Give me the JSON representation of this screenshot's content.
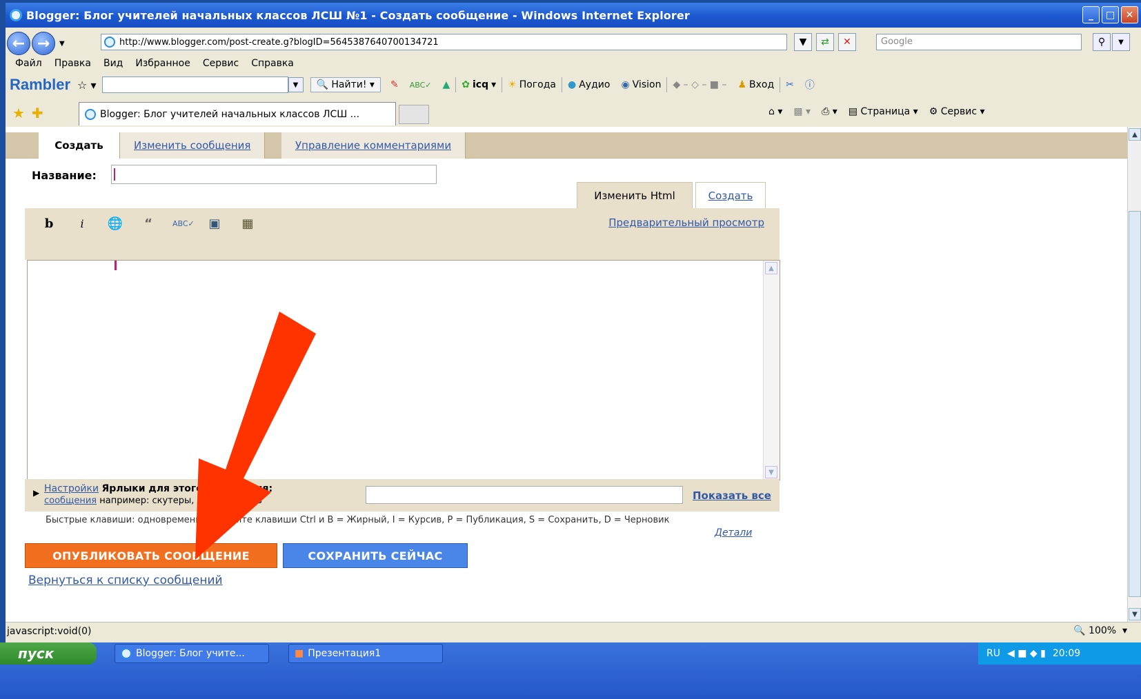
{
  "window": {
    "title": "Blogger: Блог учителей начальных классов ЛСШ №1 - Создать сообщение - Windows Internet Explorer",
    "buttons": [
      "_",
      "□",
      "✕"
    ]
  },
  "address": {
    "url": "http://www.blogger.com/post-create.g?blogID=5645387640700134721",
    "search_placeholder": "Google"
  },
  "menu": [
    "Файл",
    "Правка",
    "Вид",
    "Избранное",
    "Сервис",
    "Справка"
  ],
  "rambler": {
    "logo": "Rambler",
    "find": "Найти!",
    "items": [
      "icq",
      "Погода",
      "Аудио",
      "Vision",
      "Вход"
    ]
  },
  "tab": {
    "title": "Blogger: Блог учителей начальных классов ЛСШ ..."
  },
  "commandbar": {
    "page": "Страница",
    "tools": "Сервис"
  },
  "blogger": {
    "tabs": [
      "Создать",
      "Изменить сообщения",
      "Управление комментариями"
    ],
    "title_label": "Название:",
    "editor_tabs": [
      "Изменить Html",
      "Создать"
    ],
    "preview": "Предварительный просмотр",
    "settings_link_1": "Настройки",
    "settings_link_2": "сообщения",
    "labels_text_1": "Ярлыки для этого сообщения:",
    "labels_text_2": "например: скутеры, отпуск, осень",
    "show_all": "Показать все",
    "shortcuts": "Быстрые клавиши: одновременно нажмите клавиши Ctrl и B = Жирный, I = Курсив, P = Публикация, S = Сохранить, D = Черновик",
    "details": "Детали",
    "publish": "ОПУБЛИКОВАТЬ СООБЩЕНИЕ",
    "save": "СОХРАНИТЬ СЕЙЧАС",
    "back": "Вернуться к списку сообщений"
  },
  "statusbar": {
    "text": "javascript:void(0)",
    "zoom": "100%"
  },
  "taskbar": {
    "start": "пуск",
    "items": [
      "Blogger: Блог учите...",
      "Презентация1"
    ],
    "lang": "RU",
    "time": "20:09"
  },
  "colors": {
    "arrow": "#ff3300",
    "publish": "#f26f1f",
    "save": "#4a86e8",
    "blogger_bar": "#e9e0cc"
  }
}
